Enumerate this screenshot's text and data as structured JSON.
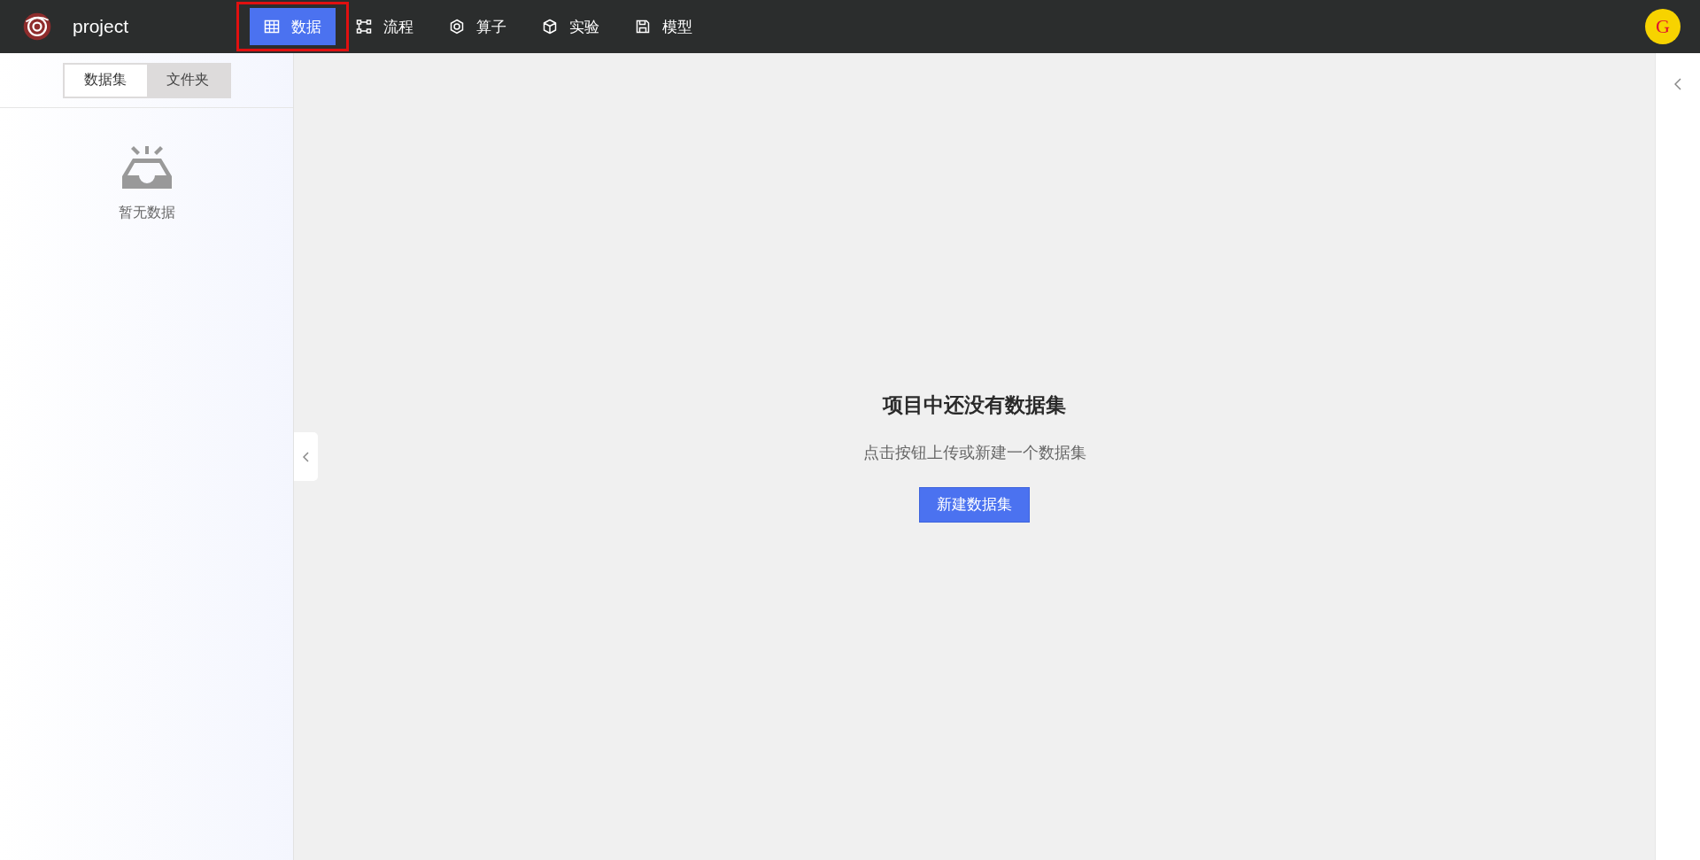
{
  "header": {
    "project": "project",
    "avatar": "G",
    "nav": [
      {
        "label": "数据",
        "kind": "table",
        "selected": true,
        "highlighted": true
      },
      {
        "label": "流程",
        "kind": "flow",
        "selected": false,
        "highlighted": false
      },
      {
        "label": "算子",
        "kind": "hexagon",
        "selected": false,
        "highlighted": false
      },
      {
        "label": "实验",
        "kind": "cube",
        "selected": false,
        "highlighted": false
      },
      {
        "label": "模型",
        "kind": "save",
        "selected": false,
        "highlighted": false
      }
    ]
  },
  "sidebar": {
    "tabs": [
      {
        "label": "数据集",
        "selected": true
      },
      {
        "label": "文件夹",
        "selected": false
      }
    ],
    "empty_text": "暂无数据"
  },
  "main": {
    "title": "项目中还没有数据集",
    "subtitle": "点击按钮上传或新建一个数据集",
    "button": "新建数据集"
  }
}
